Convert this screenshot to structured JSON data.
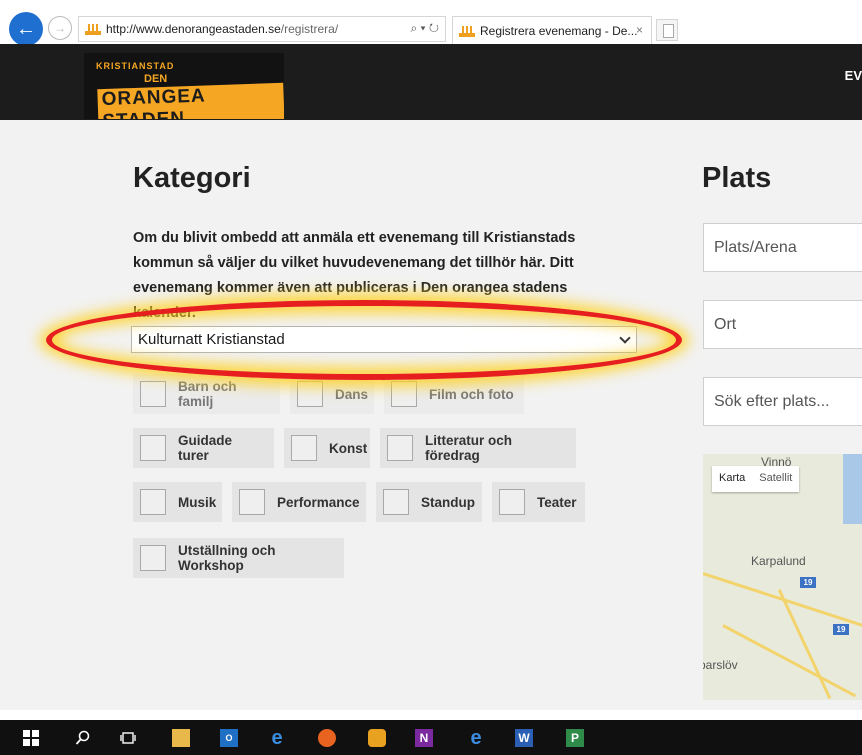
{
  "browser": {
    "url_domain": "http://www.denorangeastaden.se",
    "url_path": "/registrera/",
    "address_icons": "⌕ ▾ ↻",
    "tab_title": "Registrera evenemang - De...",
    "tab_close": "×"
  },
  "header": {
    "logo_top": "KRISTIANSTAD",
    "logo_den": "DEN",
    "logo_name": "ORANGEA STADEN",
    "nav_partial": "EV"
  },
  "kategori": {
    "title": "Kategori",
    "intro": "Om du blivit ombedd att anmäla ett evenemang till Kristianstads kommun så väljer du vilket huvudevenemang det tillhör här. Ditt evenemang kommer även att publiceras i Den orangea stadens kalender.",
    "selected_event": "Kulturnatt Kristianstad",
    "categories": [
      "Barn och familj",
      "Dans",
      "Film och foto",
      "Guidade turer",
      "Konst",
      "Litteratur och föredrag",
      "Musik",
      "Performance",
      "Standup",
      "Teater",
      "Utställning och Workshop"
    ]
  },
  "plats": {
    "title": "Plats",
    "arena_placeholder": "Plats/Arena",
    "ort_placeholder": "Ort",
    "search_placeholder": "Sök efter plats...",
    "map_btn_map": "Karta",
    "map_btn_satellite": "Satellit",
    "map_labels": [
      "Vinnö",
      "Karpalund",
      "parslöv"
    ],
    "road_shields": [
      "19",
      "19"
    ]
  },
  "taskbar": {
    "app_letters": [
      "N",
      "W",
      "P"
    ]
  },
  "colors": {
    "accent_orange": "#f5a623",
    "highlight_red": "#e61e1e",
    "highlight_glow": "#ffd11e",
    "ie_blue": "#1f6fd1"
  }
}
